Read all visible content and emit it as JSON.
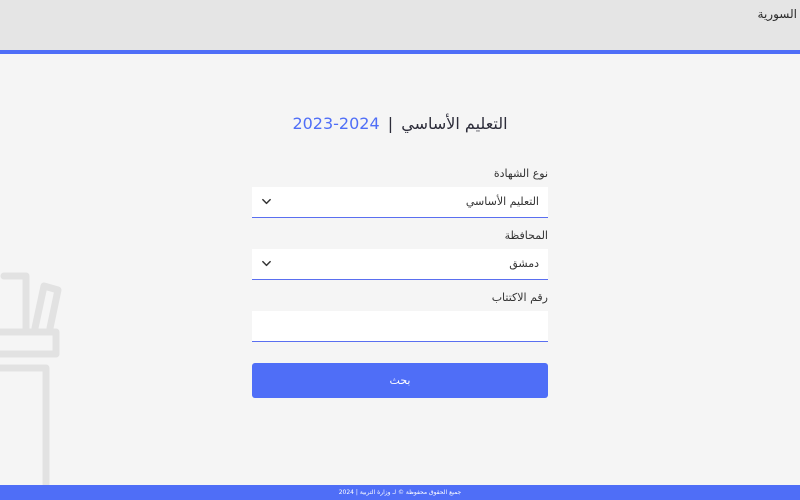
{
  "header": {
    "title": "السورية"
  },
  "form": {
    "heading": {
      "text": "التعليم الأساسي",
      "separator": "|",
      "year": "2023-2024"
    },
    "certificate_type": {
      "label": "نوع الشهادة",
      "value": "التعليم الأساسي"
    },
    "governorate": {
      "label": "المحافظة",
      "value": "دمشق"
    },
    "exam_number": {
      "label": "رقم الاكتتاب",
      "value": ""
    },
    "search_button": "بحث"
  },
  "footer": {
    "text": "جميع الحقوق محفوظة © لـ وزارة التربية | 2024"
  },
  "colors": {
    "accent": "#4f6ef7",
    "topbar": "#e5e5e5",
    "background": "#f5f5f5"
  }
}
